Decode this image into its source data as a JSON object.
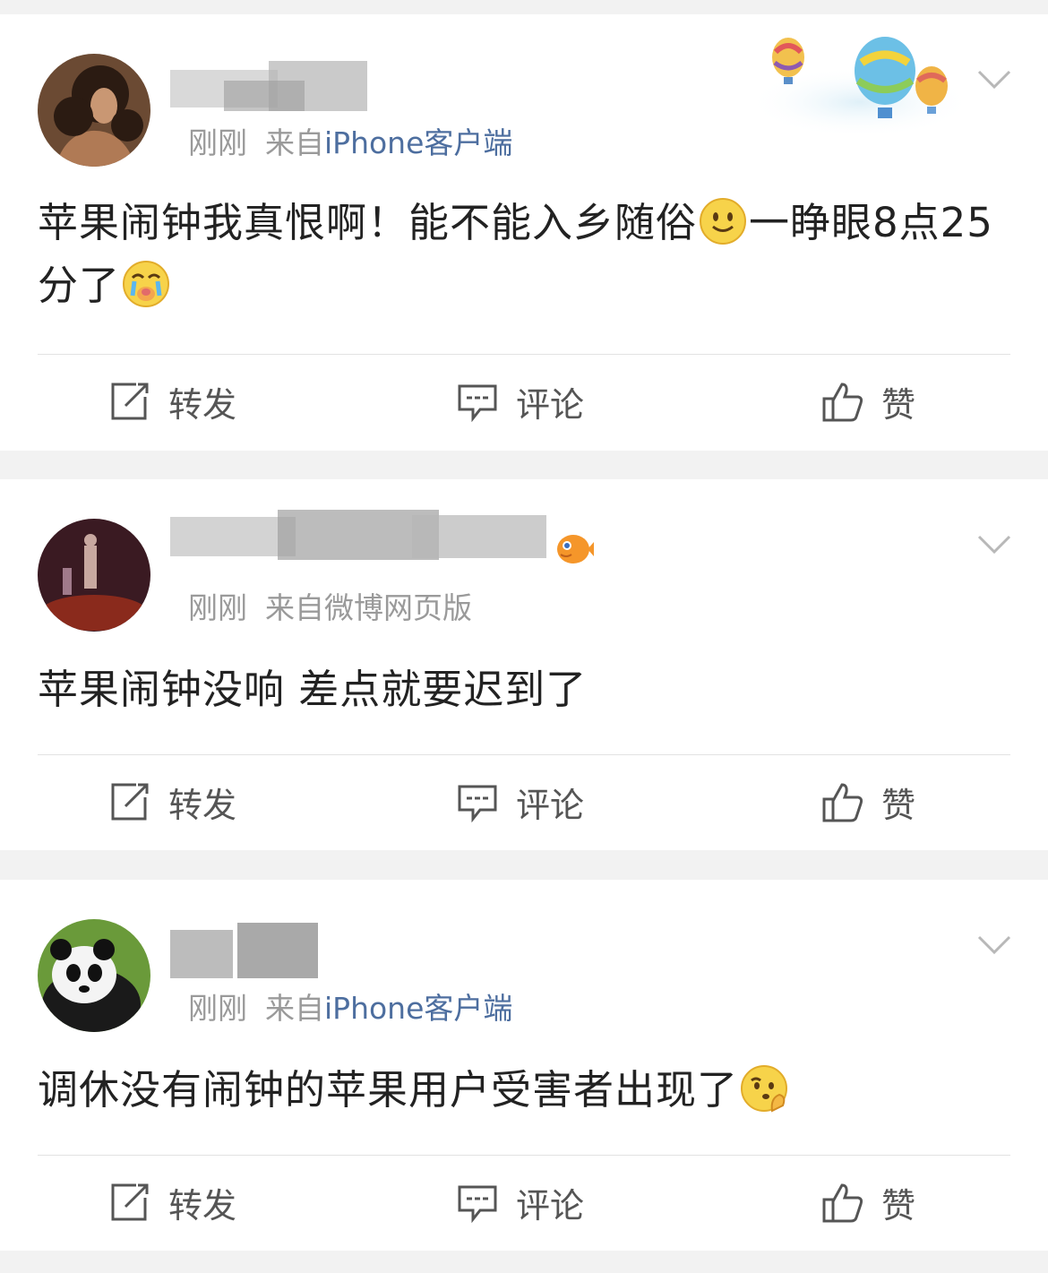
{
  "colors": {
    "source_link": "#4d6e9f",
    "meta_gray": "#9a9a9a",
    "content_text": "#222222",
    "action_text": "#555555",
    "separator_bg": "#f2f2f2"
  },
  "action_labels": {
    "repost": "转发",
    "comment": "评论",
    "like": "赞"
  },
  "posts": [
    {
      "time": "刚刚",
      "from_prefix": "来自",
      "source": "iPhone客户端",
      "source_is_link": true,
      "text_1": "苹果闹钟我真恨啊！能不能入乡随俗",
      "emoji_1": "smile-emoji",
      "text_2": "一睁眼8点25分了",
      "emoji_2": "crying-emoji",
      "avatar_icon": "curly-hair-woman-avatar",
      "header_decoration": "hot-air-balloons"
    },
    {
      "time": "刚刚",
      "from_prefix": "来自",
      "source": "微博网页版",
      "source_is_link": false,
      "text_1": "苹果闹钟没响 差点就要迟到了",
      "avatar_icon": "stage-performance-avatar",
      "badge_icon": "pufferfish-badge"
    },
    {
      "time": "刚刚",
      "from_prefix": "来自",
      "source": "iPhone客户端",
      "source_is_link": true,
      "text_1": "调休没有闹钟的苹果用户受害者出现了",
      "emoji_1": "thinking-emoji",
      "avatar_icon": "panda-avatar"
    }
  ]
}
